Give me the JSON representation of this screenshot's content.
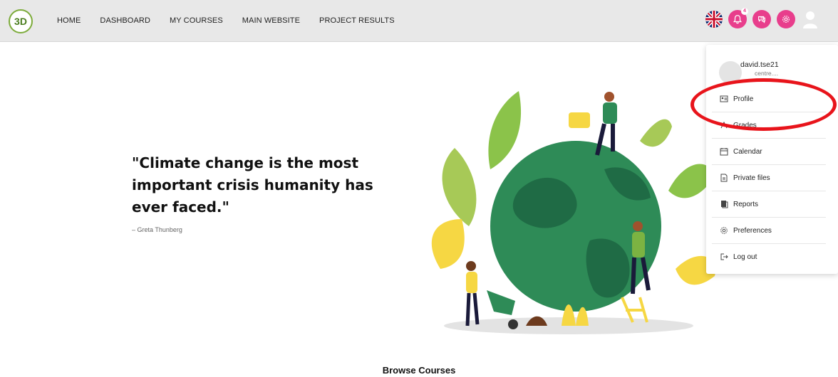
{
  "nav": {
    "logo_text": "3D",
    "links": [
      "HOME",
      "DASHBOARD",
      "MY COURSES",
      "MAIN WEBSITE",
      "PROJECT RESULTS"
    ],
    "notification_count": "4"
  },
  "hero": {
    "quote": "\"Climate change is the most important crisis humanity has ever faced.\"",
    "author": "– Greta Thunberg"
  },
  "user_menu": {
    "username": "david.tse21",
    "email": "centre....",
    "items": [
      "Profile",
      "Grades",
      "Calendar",
      "Private files",
      "Reports",
      "Preferences",
      "Log out"
    ]
  },
  "browse": {
    "title": "Browse Courses"
  },
  "colors": {
    "accent": "#e83e8c",
    "highlight": "#e8141b",
    "brand_green": "#7cab3a"
  }
}
